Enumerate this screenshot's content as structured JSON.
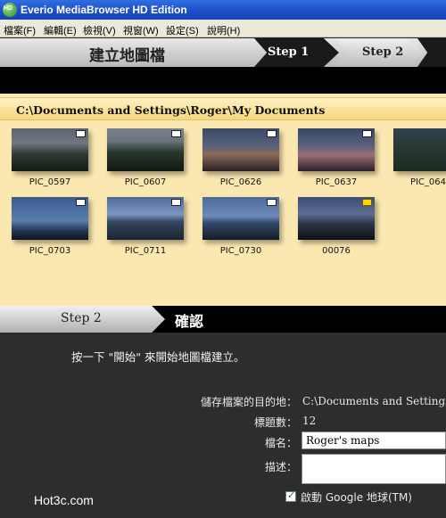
{
  "window": {
    "title": "Everio MediaBrowser HD Edition"
  },
  "menu": [
    "檔案(F)",
    "編輯(E)",
    "檢視(V)",
    "視窗(W)",
    "設定(S)",
    "說明(H)"
  ],
  "steps": {
    "header_title": "建立地圖檔",
    "step1": "Step 1",
    "step2": "Step 2"
  },
  "browser": {
    "path": "C:\\Documents and Settings\\Roger\\My Documents",
    "thumbnails": [
      {
        "caption": "PIC_0597",
        "badge": "photo-icon"
      },
      {
        "caption": "PIC_0607",
        "badge": "photo-icon"
      },
      {
        "caption": "PIC_0626",
        "badge": "photo-icon"
      },
      {
        "caption": "PIC_0637",
        "badge": "photo-icon"
      },
      {
        "caption": "PIC_064",
        "badge": "photo-icon"
      },
      {
        "caption": "PIC_0703",
        "badge": "photo-icon"
      },
      {
        "caption": "PIC_0711",
        "badge": "photo-icon"
      },
      {
        "caption": "PIC_0730",
        "badge": "photo-icon"
      },
      {
        "caption": "00076",
        "badge": "video-icon"
      }
    ]
  },
  "step2": {
    "step_label": "Step 2",
    "title": "確認",
    "instruction": "按一下 \"開始\" 來開始地圖檔建立。",
    "dest_label": "儲存檔案的目的地：",
    "dest_value": "C:\\Documents and Settings\\R",
    "count_label": "標題數：",
    "count_value": "12",
    "filename_label": "檔名：",
    "filename_value": "Roger's maps",
    "desc_label": "描述：",
    "desc_value": "",
    "google_earth_label": "啟動 Google 地球(TM)",
    "google_earth_checked": true
  },
  "watermark": "Hot3c.com"
}
